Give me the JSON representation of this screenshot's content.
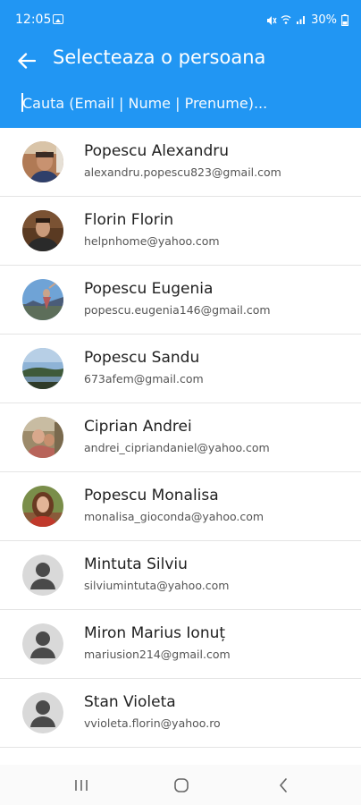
{
  "status_bar": {
    "time": "12:05",
    "battery": "30%",
    "icons": [
      "gallery-icon",
      "mute-icon",
      "wifi-icon",
      "signal-icon",
      "battery-icon"
    ]
  },
  "app_bar": {
    "title": "Selecteaza o persoana",
    "back_icon": "arrow-left-icon",
    "color": "#2196f3"
  },
  "search": {
    "placeholder": "Cauta (Email | Nume | Prenume)..."
  },
  "contacts": [
    {
      "name": "Popescu Alexandru",
      "email": "alexandru.popescu823@gmail.com",
      "avatar": "photo"
    },
    {
      "name": "Florin Florin",
      "email": "helpnhome@yahoo.com",
      "avatar": "photo"
    },
    {
      "name": "Popescu Eugenia",
      "email": "popescu.eugenia146@gmail.com",
      "avatar": "photo"
    },
    {
      "name": "Popescu Sandu",
      "email": "673afem@gmail.com",
      "avatar": "photo"
    },
    {
      "name": "Ciprian Andrei",
      "email": "andrei_cipriandaniel@yahoo.com",
      "avatar": "photo"
    },
    {
      "name": "Popescu Monalisa",
      "email": "monalisa_gioconda@yahoo.com",
      "avatar": "photo"
    },
    {
      "name": "Mintuta Silviu",
      "email": "silviumintuta@yahoo.com",
      "avatar": "default-person-icon"
    },
    {
      "name": "Miron Marius Ionuț",
      "email": "mariusion214@gmail.com",
      "avatar": "default-person-icon"
    },
    {
      "name": "Stan Violeta",
      "email": "vvioleta.florin@yahoo.ro",
      "avatar": "default-person-icon"
    }
  ],
  "nav_bar": {
    "icons": [
      "recent-apps-icon",
      "home-icon",
      "back-icon"
    ]
  }
}
